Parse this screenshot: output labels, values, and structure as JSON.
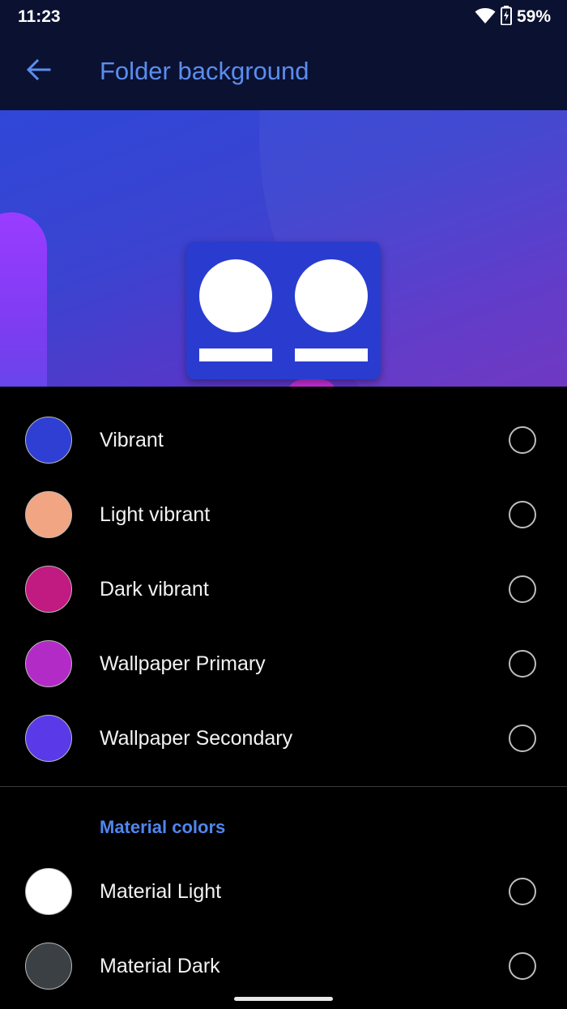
{
  "status_bar": {
    "time": "11:23",
    "battery": "59%",
    "icons": [
      "wifi-icon",
      "battery-icon"
    ]
  },
  "app_bar": {
    "back_icon": "arrow-left-icon",
    "title": "Folder background"
  },
  "colors": {
    "accent": "#5b8def",
    "app_bar_bg": "#0b1130",
    "background": "#000000"
  },
  "options": [
    {
      "label": "Vibrant",
      "color": "#2f3fd3",
      "selected": false
    },
    {
      "label": "Light vibrant",
      "color": "#f2a582",
      "selected": false
    },
    {
      "label": "Dark vibrant",
      "color": "#c11a80",
      "selected": false
    },
    {
      "label": "Wallpaper Primary",
      "color": "#b32bc7",
      "selected": false
    },
    {
      "label": "Wallpaper Secondary",
      "color": "#5a3ae8",
      "selected": false
    }
  ],
  "material_section": {
    "header": "Material colors",
    "options": [
      {
        "label": "Material Light",
        "color": "#ffffff",
        "selected": false
      },
      {
        "label": "Material Dark",
        "color": "#3b4044",
        "selected": false
      }
    ]
  }
}
